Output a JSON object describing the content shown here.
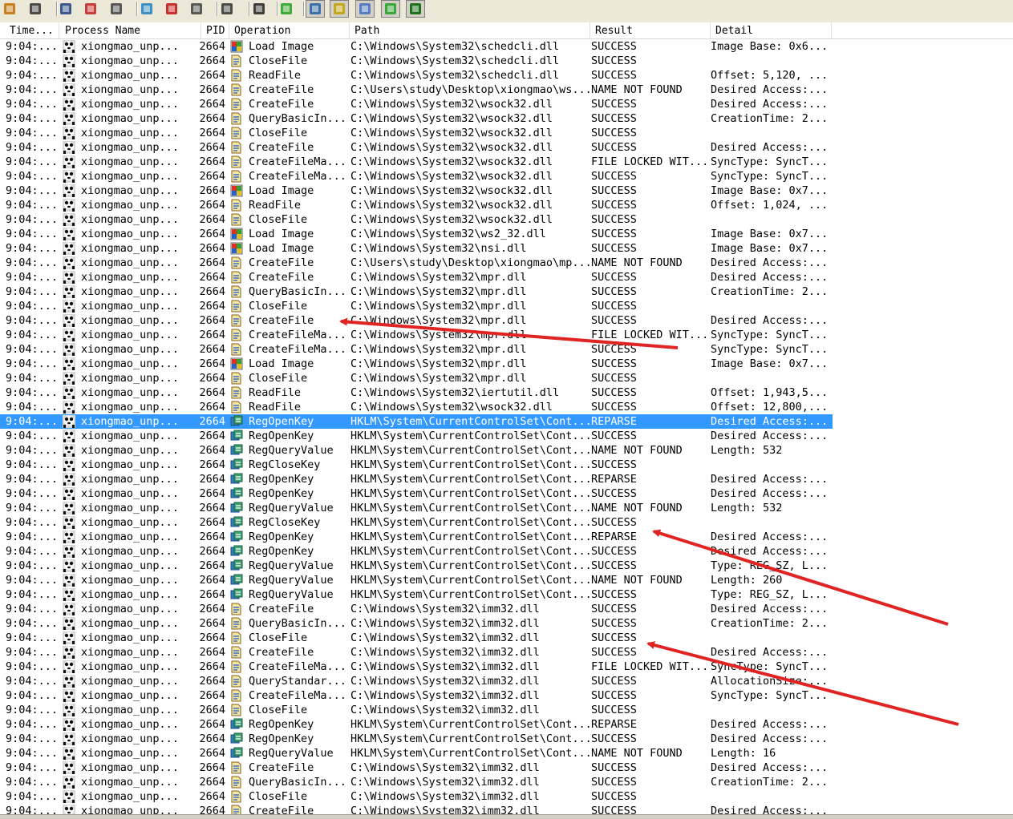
{
  "toolbar": {
    "icons": [
      "open-icon",
      "save-icon",
      "magnifier-icon",
      "clear-display-icon",
      "autoscroll-icon",
      "filter-icon",
      "highlight-icon",
      "target-icon",
      "event-properties-icon",
      "find-icon",
      "jump-icon",
      "registry-activity-icon",
      "file-activity-icon",
      "network-activity-icon",
      "process-activity-icon",
      "profiling-icon"
    ]
  },
  "columns": [
    "Time...",
    "Process Name",
    "PID",
    "Operation",
    "Path",
    "Result",
    "Detail"
  ],
  "rows": [
    {
      "time": "9:04:...",
      "proc": "xiongmao_unp...",
      "pid": "2664",
      "op": "Load Image",
      "kind": "image",
      "path": "C:\\Windows\\System32\\schedcli.dll",
      "result": "SUCCESS",
      "detail": "Image Base: 0x6..."
    },
    {
      "time": "9:04:...",
      "proc": "xiongmao_unp...",
      "pid": "2664",
      "op": "CloseFile",
      "kind": "file",
      "path": "C:\\Windows\\System32\\schedcli.dll",
      "result": "SUCCESS",
      "detail": ""
    },
    {
      "time": "9:04:...",
      "proc": "xiongmao_unp...",
      "pid": "2664",
      "op": "ReadFile",
      "kind": "file",
      "path": "C:\\Windows\\System32\\schedcli.dll",
      "result": "SUCCESS",
      "detail": "Offset: 5,120, ..."
    },
    {
      "time": "9:04:...",
      "proc": "xiongmao_unp...",
      "pid": "2664",
      "op": "CreateFile",
      "kind": "file",
      "path": "C:\\Users\\study\\Desktop\\xiongmao\\ws...",
      "result": "NAME NOT FOUND",
      "detail": "Desired Access:..."
    },
    {
      "time": "9:04:...",
      "proc": "xiongmao_unp...",
      "pid": "2664",
      "op": "CreateFile",
      "kind": "file",
      "path": "C:\\Windows\\System32\\wsock32.dll",
      "result": "SUCCESS",
      "detail": "Desired Access:..."
    },
    {
      "time": "9:04:...",
      "proc": "xiongmao_unp...",
      "pid": "2664",
      "op": "QueryBasicIn...",
      "kind": "file",
      "path": "C:\\Windows\\System32\\wsock32.dll",
      "result": "SUCCESS",
      "detail": "CreationTime: 2..."
    },
    {
      "time": "9:04:...",
      "proc": "xiongmao_unp...",
      "pid": "2664",
      "op": "CloseFile",
      "kind": "file",
      "path": "C:\\Windows\\System32\\wsock32.dll",
      "result": "SUCCESS",
      "detail": ""
    },
    {
      "time": "9:04:...",
      "proc": "xiongmao_unp...",
      "pid": "2664",
      "op": "CreateFile",
      "kind": "file",
      "path": "C:\\Windows\\System32\\wsock32.dll",
      "result": "SUCCESS",
      "detail": "Desired Access:..."
    },
    {
      "time": "9:04:...",
      "proc": "xiongmao_unp...",
      "pid": "2664",
      "op": "CreateFileMa...",
      "kind": "file",
      "path": "C:\\Windows\\System32\\wsock32.dll",
      "result": "FILE LOCKED WIT...",
      "detail": "SyncType: SyncT..."
    },
    {
      "time": "9:04:...",
      "proc": "xiongmao_unp...",
      "pid": "2664",
      "op": "CreateFileMa...",
      "kind": "file",
      "path": "C:\\Windows\\System32\\wsock32.dll",
      "result": "SUCCESS",
      "detail": "SyncType: SyncT..."
    },
    {
      "time": "9:04:...",
      "proc": "xiongmao_unp...",
      "pid": "2664",
      "op": "Load Image",
      "kind": "image",
      "path": "C:\\Windows\\System32\\wsock32.dll",
      "result": "SUCCESS",
      "detail": "Image Base: 0x7..."
    },
    {
      "time": "9:04:...",
      "proc": "xiongmao_unp...",
      "pid": "2664",
      "op": "ReadFile",
      "kind": "file",
      "path": "C:\\Windows\\System32\\wsock32.dll",
      "result": "SUCCESS",
      "detail": "Offset: 1,024, ..."
    },
    {
      "time": "9:04:...",
      "proc": "xiongmao_unp...",
      "pid": "2664",
      "op": "CloseFile",
      "kind": "file",
      "path": "C:\\Windows\\System32\\wsock32.dll",
      "result": "SUCCESS",
      "detail": ""
    },
    {
      "time": "9:04:...",
      "proc": "xiongmao_unp...",
      "pid": "2664",
      "op": "Load Image",
      "kind": "image",
      "path": "C:\\Windows\\System32\\ws2_32.dll",
      "result": "SUCCESS",
      "detail": "Image Base: 0x7..."
    },
    {
      "time": "9:04:...",
      "proc": "xiongmao_unp...",
      "pid": "2664",
      "op": "Load Image",
      "kind": "image",
      "path": "C:\\Windows\\System32\\nsi.dll",
      "result": "SUCCESS",
      "detail": "Image Base: 0x7..."
    },
    {
      "time": "9:04:...",
      "proc": "xiongmao_unp...",
      "pid": "2664",
      "op": "CreateFile",
      "kind": "file",
      "path": "C:\\Users\\study\\Desktop\\xiongmao\\mp...",
      "result": "NAME NOT FOUND",
      "detail": "Desired Access:..."
    },
    {
      "time": "9:04:...",
      "proc": "xiongmao_unp...",
      "pid": "2664",
      "op": "CreateFile",
      "kind": "file",
      "path": "C:\\Windows\\System32\\mpr.dll",
      "result": "SUCCESS",
      "detail": "Desired Access:..."
    },
    {
      "time": "9:04:...",
      "proc": "xiongmao_unp...",
      "pid": "2664",
      "op": "QueryBasicIn...",
      "kind": "file",
      "path": "C:\\Windows\\System32\\mpr.dll",
      "result": "SUCCESS",
      "detail": "CreationTime: 2..."
    },
    {
      "time": "9:04:...",
      "proc": "xiongmao_unp...",
      "pid": "2664",
      "op": "CloseFile",
      "kind": "file",
      "path": "C:\\Windows\\System32\\mpr.dll",
      "result": "SUCCESS",
      "detail": ""
    },
    {
      "time": "9:04:...",
      "proc": "xiongmao_unp...",
      "pid": "2664",
      "op": "CreateFile",
      "kind": "file",
      "path": "C:\\Windows\\System32\\mpr.dll",
      "result": "SUCCESS",
      "detail": "Desired Access:..."
    },
    {
      "time": "9:04:...",
      "proc": "xiongmao_unp...",
      "pid": "2664",
      "op": "CreateFileMa...",
      "kind": "file",
      "path": "C:\\Windows\\System32\\mpr.dll",
      "result": "FILE LOCKED WIT...",
      "detail": "SyncType: SyncT..."
    },
    {
      "time": "9:04:...",
      "proc": "xiongmao_unp...",
      "pid": "2664",
      "op": "CreateFileMa...",
      "kind": "file",
      "path": "C:\\Windows\\System32\\mpr.dll",
      "result": "SUCCESS",
      "detail": "SyncType: SyncT..."
    },
    {
      "time": "9:04:...",
      "proc": "xiongmao_unp...",
      "pid": "2664",
      "op": "Load Image",
      "kind": "image",
      "path": "C:\\Windows\\System32\\mpr.dll",
      "result": "SUCCESS",
      "detail": "Image Base: 0x7..."
    },
    {
      "time": "9:04:...",
      "proc": "xiongmao_unp...",
      "pid": "2664",
      "op": "CloseFile",
      "kind": "file",
      "path": "C:\\Windows\\System32\\mpr.dll",
      "result": "SUCCESS",
      "detail": ""
    },
    {
      "time": "9:04:...",
      "proc": "xiongmao_unp...",
      "pid": "2664",
      "op": "ReadFile",
      "kind": "file",
      "path": "C:\\Windows\\System32\\iertutil.dll",
      "result": "SUCCESS",
      "detail": "Offset: 1,943,5..."
    },
    {
      "time": "9:04:...",
      "proc": "xiongmao_unp...",
      "pid": "2664",
      "op": "ReadFile",
      "kind": "file",
      "path": "C:\\Windows\\System32\\wsock32.dll",
      "result": "SUCCESS",
      "detail": "Offset: 12,800,..."
    },
    {
      "time": "9:04:...",
      "proc": "xiongmao_unp...",
      "pid": "2664",
      "op": "RegOpenKey",
      "kind": "reg",
      "path": "HKLM\\System\\CurrentControlSet\\Cont...",
      "result": "REPARSE",
      "detail": "Desired Access:...",
      "selected": true
    },
    {
      "time": "9:04:...",
      "proc": "xiongmao_unp...",
      "pid": "2664",
      "op": "RegOpenKey",
      "kind": "reg",
      "path": "HKLM\\System\\CurrentControlSet\\Cont...",
      "result": "SUCCESS",
      "detail": "Desired Access:..."
    },
    {
      "time": "9:04:...",
      "proc": "xiongmao_unp...",
      "pid": "2664",
      "op": "RegQueryValue",
      "kind": "reg",
      "path": "HKLM\\System\\CurrentControlSet\\Cont...",
      "result": "NAME NOT FOUND",
      "detail": "Length: 532"
    },
    {
      "time": "9:04:...",
      "proc": "xiongmao_unp...",
      "pid": "2664",
      "op": "RegCloseKey",
      "kind": "reg",
      "path": "HKLM\\System\\CurrentControlSet\\Cont...",
      "result": "SUCCESS",
      "detail": ""
    },
    {
      "time": "9:04:...",
      "proc": "xiongmao_unp...",
      "pid": "2664",
      "op": "RegOpenKey",
      "kind": "reg",
      "path": "HKLM\\System\\CurrentControlSet\\Cont...",
      "result": "REPARSE",
      "detail": "Desired Access:..."
    },
    {
      "time": "9:04:...",
      "proc": "xiongmao_unp...",
      "pid": "2664",
      "op": "RegOpenKey",
      "kind": "reg",
      "path": "HKLM\\System\\CurrentControlSet\\Cont...",
      "result": "SUCCESS",
      "detail": "Desired Access:..."
    },
    {
      "time": "9:04:...",
      "proc": "xiongmao_unp...",
      "pid": "2664",
      "op": "RegQueryValue",
      "kind": "reg",
      "path": "HKLM\\System\\CurrentControlSet\\Cont...",
      "result": "NAME NOT FOUND",
      "detail": "Length: 532"
    },
    {
      "time": "9:04:...",
      "proc": "xiongmao_unp...",
      "pid": "2664",
      "op": "RegCloseKey",
      "kind": "reg",
      "path": "HKLM\\System\\CurrentControlSet\\Cont...",
      "result": "SUCCESS",
      "detail": ""
    },
    {
      "time": "9:04:...",
      "proc": "xiongmao_unp...",
      "pid": "2664",
      "op": "RegOpenKey",
      "kind": "reg",
      "path": "HKLM\\System\\CurrentControlSet\\Cont...",
      "result": "REPARSE",
      "detail": "Desired Access:..."
    },
    {
      "time": "9:04:...",
      "proc": "xiongmao_unp...",
      "pid": "2664",
      "op": "RegOpenKey",
      "kind": "reg",
      "path": "HKLM\\System\\CurrentControlSet\\Cont...",
      "result": "SUCCESS",
      "detail": "Desired Access:..."
    },
    {
      "time": "9:04:...",
      "proc": "xiongmao_unp...",
      "pid": "2664",
      "op": "RegQueryValue",
      "kind": "reg",
      "path": "HKLM\\System\\CurrentControlSet\\Cont...",
      "result": "SUCCESS",
      "detail": "Type: REG_SZ, L..."
    },
    {
      "time": "9:04:...",
      "proc": "xiongmao_unp...",
      "pid": "2664",
      "op": "RegQueryValue",
      "kind": "reg",
      "path": "HKLM\\System\\CurrentControlSet\\Cont...",
      "result": "NAME NOT FOUND",
      "detail": "Length: 260"
    },
    {
      "time": "9:04:...",
      "proc": "xiongmao_unp...",
      "pid": "2664",
      "op": "RegQueryValue",
      "kind": "reg",
      "path": "HKLM\\System\\CurrentControlSet\\Cont...",
      "result": "SUCCESS",
      "detail": "Type: REG_SZ, L..."
    },
    {
      "time": "9:04:...",
      "proc": "xiongmao_unp...",
      "pid": "2664",
      "op": "CreateFile",
      "kind": "file",
      "path": "C:\\Windows\\System32\\imm32.dll",
      "result": "SUCCESS",
      "detail": "Desired Access:..."
    },
    {
      "time": "9:04:...",
      "proc": "xiongmao_unp...",
      "pid": "2664",
      "op": "QueryBasicIn...",
      "kind": "file",
      "path": "C:\\Windows\\System32\\imm32.dll",
      "result": "SUCCESS",
      "detail": "CreationTime: 2..."
    },
    {
      "time": "9:04:...",
      "proc": "xiongmao_unp...",
      "pid": "2664",
      "op": "CloseFile",
      "kind": "file",
      "path": "C:\\Windows\\System32\\imm32.dll",
      "result": "SUCCESS",
      "detail": ""
    },
    {
      "time": "9:04:...",
      "proc": "xiongmao_unp...",
      "pid": "2664",
      "op": "CreateFile",
      "kind": "file",
      "path": "C:\\Windows\\System32\\imm32.dll",
      "result": "SUCCESS",
      "detail": "Desired Access:..."
    },
    {
      "time": "9:04:...",
      "proc": "xiongmao_unp...",
      "pid": "2664",
      "op": "CreateFileMa...",
      "kind": "file",
      "path": "C:\\Windows\\System32\\imm32.dll",
      "result": "FILE LOCKED WIT...",
      "detail": "SyncType: SyncT..."
    },
    {
      "time": "9:04:...",
      "proc": "xiongmao_unp...",
      "pid": "2664",
      "op": "QueryStandar...",
      "kind": "file",
      "path": "C:\\Windows\\System32\\imm32.dll",
      "result": "SUCCESS",
      "detail": "AllocationSize:..."
    },
    {
      "time": "9:04:...",
      "proc": "xiongmao_unp...",
      "pid": "2664",
      "op": "CreateFileMa...",
      "kind": "file",
      "path": "C:\\Windows\\System32\\imm32.dll",
      "result": "SUCCESS",
      "detail": "SyncType: SyncT..."
    },
    {
      "time": "9:04:...",
      "proc": "xiongmao_unp...",
      "pid": "2664",
      "op": "CloseFile",
      "kind": "file",
      "path": "C:\\Windows\\System32\\imm32.dll",
      "result": "SUCCESS",
      "detail": ""
    },
    {
      "time": "9:04:...",
      "proc": "xiongmao_unp...",
      "pid": "2664",
      "op": "RegOpenKey",
      "kind": "reg",
      "path": "HKLM\\System\\CurrentControlSet\\Cont...",
      "result": "REPARSE",
      "detail": "Desired Access:..."
    },
    {
      "time": "9:04:...",
      "proc": "xiongmao_unp...",
      "pid": "2664",
      "op": "RegOpenKey",
      "kind": "reg",
      "path": "HKLM\\System\\CurrentControlSet\\Cont...",
      "result": "SUCCESS",
      "detail": "Desired Access:..."
    },
    {
      "time": "9:04:...",
      "proc": "xiongmao_unp...",
      "pid": "2664",
      "op": "RegQueryValue",
      "kind": "reg",
      "path": "HKLM\\System\\CurrentControlSet\\Cont...",
      "result": "NAME NOT FOUND",
      "detail": "Length: 16"
    },
    {
      "time": "9:04:...",
      "proc": "xiongmao_unp...",
      "pid": "2664",
      "op": "CreateFile",
      "kind": "file",
      "path": "C:\\Windows\\System32\\imm32.dll",
      "result": "SUCCESS",
      "detail": "Desired Access:..."
    },
    {
      "time": "9:04:...",
      "proc": "xiongmao_unp...",
      "pid": "2664",
      "op": "QueryBasicIn...",
      "kind": "file",
      "path": "C:\\Windows\\System32\\imm32.dll",
      "result": "SUCCESS",
      "detail": "CreationTime: 2..."
    },
    {
      "time": "9:04:...",
      "proc": "xiongmao_unp...",
      "pid": "2664",
      "op": "CloseFile",
      "kind": "file",
      "path": "C:\\Windows\\System32\\imm32.dll",
      "result": "SUCCESS",
      "detail": ""
    },
    {
      "time": "9:04:...",
      "proc": "xiongmao_unp...",
      "pid": "2664",
      "op": "CreateFile",
      "kind": "file",
      "path": "C:\\Windows\\System32\\imm32.dll",
      "result": "SUCCESS",
      "detail": "Desired Access:..."
    }
  ],
  "colors": {
    "selection": "#3399ff",
    "annotation_arrow": "#e02424"
  }
}
